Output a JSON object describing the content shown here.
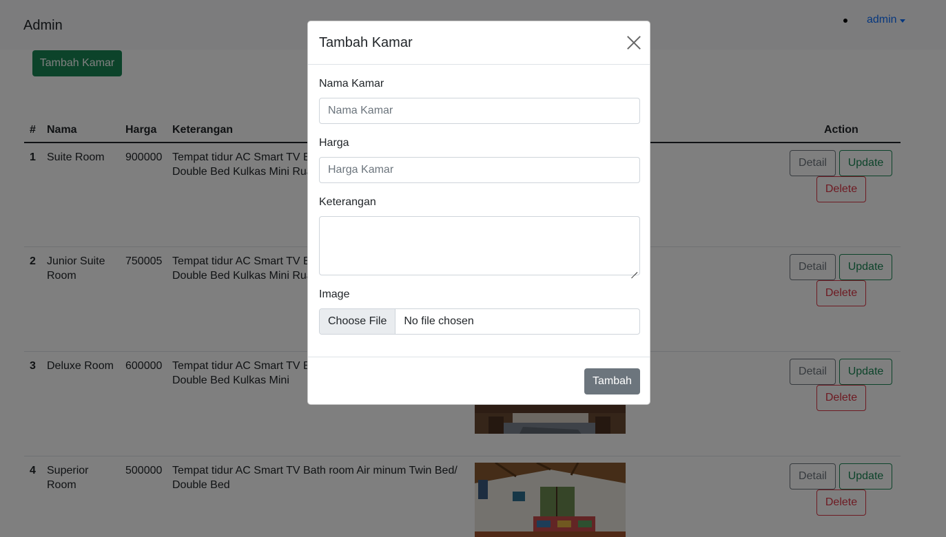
{
  "navbar": {
    "brand": "Admin",
    "user": "admin"
  },
  "add_button": "Tambah Kamar",
  "table": {
    "headers": {
      "num": "#",
      "name": "Nama",
      "price": "Harga",
      "desc": "Keterangan",
      "action": "Action"
    },
    "rows": [
      {
        "num": "1",
        "name": "Suite Room",
        "price": "900000",
        "desc": "Tempat tidur AC Smart TV Bath room Air minum Twin Bed/ Double Bed Kulkas Mini Ruang tamu"
      },
      {
        "num": "2",
        "name": "Junior Suite Room",
        "price": "750005",
        "desc": "Tempat tidur AC Smart TV Bath room Air minum Twin Bed/ Double Bed Kulkas Mini Ruang tamu"
      },
      {
        "num": "3",
        "name": "Deluxe Room",
        "price": "600000",
        "desc": "Tempat tidur AC Smart TV Bath room Air minum Twin Bed/ Double Bed Kulkas Mini"
      },
      {
        "num": "4",
        "name": "Superior Room",
        "price": "500000",
        "desc": "Tempat tidur AC Smart TV Bath room Air minum Twin Bed/ Double Bed"
      }
    ],
    "actions": {
      "detail": "Detail",
      "update": "Update",
      "delete": "Delete"
    }
  },
  "modal": {
    "title": "Tambah Kamar",
    "name_label": "Nama Kamar",
    "name_placeholder": "Nama Kamar",
    "price_label": "Harga",
    "price_placeholder": "Harga Kamar",
    "desc_label": "Keterangan",
    "image_label": "Image",
    "file_button": "Choose File",
    "file_status": "No file chosen",
    "submit": "Tambah"
  }
}
